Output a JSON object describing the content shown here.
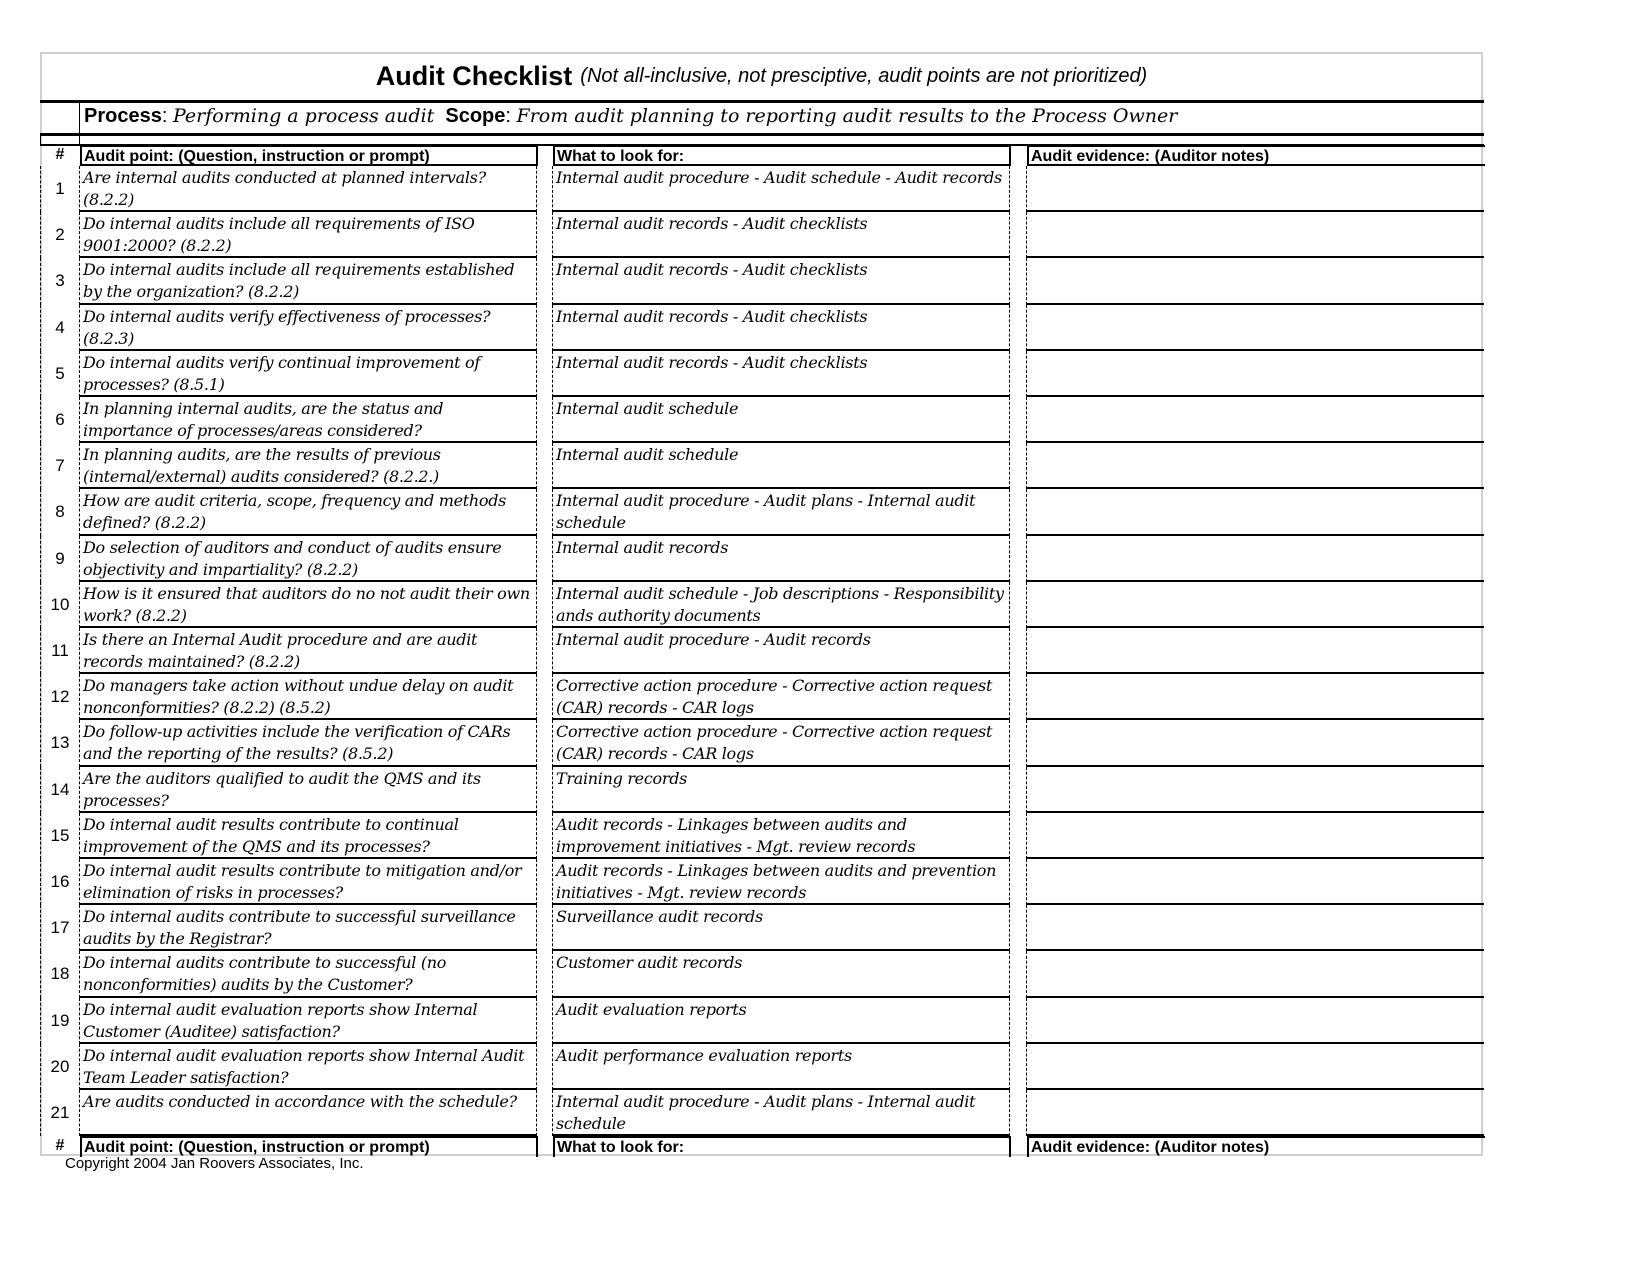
{
  "title": {
    "main": "Audit Checklist",
    "subtitle": "(Not all-inclusive, not presciptive, audit points are not prioritized)"
  },
  "process": {
    "process_label": "Process",
    "process_value": "Performing a process audit",
    "scope_label": "Scope",
    "scope_value": "From audit planning to reporting audit results to the Process Owner"
  },
  "headers": {
    "num": "#",
    "audit_point": "Audit point: (Question, instruction or prompt)",
    "look_for": "What to look for:",
    "evidence": "Audit evidence: (Auditor notes)"
  },
  "rows": [
    {
      "num": "1",
      "question": "Are internal audits conducted at planned intervals? (8.2.2)",
      "look_for": "Internal audit procedure - Audit schedule - Audit records",
      "evidence": ""
    },
    {
      "num": "2",
      "question": "Do internal audits include all requirements  of ISO 9001:2000? (8.2.2)",
      "look_for": "Internal audit records - Audit checklists",
      "evidence": ""
    },
    {
      "num": "3",
      "question": "Do internal audits include all requirements  established by the organization? (8.2.2)",
      "look_for": "Internal audit records - Audit checklists",
      "evidence": ""
    },
    {
      "num": "4",
      "question": "Do internal audits verify effectiveness of processes? (8.2.3)",
      "look_for": "Internal audit records - Audit checklists",
      "evidence": ""
    },
    {
      "num": "5",
      "question": "Do internal audits verify continual improvement of processes? (8.5.1)",
      "look_for": "Internal audit records - Audit checklists",
      "evidence": ""
    },
    {
      "num": "6",
      "question": "In planning internal audits, are the status and importance of processes/areas considered?",
      "look_for": "Internal audit schedule",
      "evidence": ""
    },
    {
      "num": "7",
      "question": "In planning audits, are the results of previous (internal/external) audits considered? (8.2.2.)",
      "look_for": "Internal audit schedule",
      "evidence": ""
    },
    {
      "num": "8",
      "question": "How are audit criteria, scope, frequency and methods defined? (8.2.2)",
      "look_for": "Internal audit procedure - Audit plans - Internal audit schedule",
      "evidence": ""
    },
    {
      "num": "9",
      "question": "Do selection of auditors and conduct of audits ensure objectivity and impartiality? (8.2.2)",
      "look_for": "Internal audit records",
      "evidence": ""
    },
    {
      "num": "10",
      "question": "How is it ensured that auditors do no not audit their own work? (8.2.2)",
      "look_for": "Internal audit schedule - Job descriptions - Responsibility ands authority documents",
      "evidence": ""
    },
    {
      "num": "11",
      "question": "Is there an Internal Audit procedure and are  audit records maintained? (8.2.2)",
      "look_for": "Internal audit procedure - Audit records",
      "evidence": ""
    },
    {
      "num": "12",
      "question": "Do managers take action without undue delay on audit nonconformities? (8.2.2) (8.5.2)",
      "look_for": "Corrective action procedure -  Corrective action request (CAR) records - CAR logs",
      "evidence": ""
    },
    {
      "num": "13",
      "question": "Do follow-up activities include the verification of CARs and the reporting of the results? (8.5.2)",
      "look_for": "Corrective action procedure -  Corrective action request (CAR) records - CAR logs",
      "evidence": ""
    },
    {
      "num": "14",
      "question": "Are the auditors qualified to audit the QMS and its processes?",
      "look_for": "Training records",
      "evidence": ""
    },
    {
      "num": "15",
      "question": "Do internal audit results contribute to continual improvement of the QMS and its processes?",
      "look_for": "Audit records - Linkages between audits and improvement initiatives - Mgt. review records",
      "evidence": ""
    },
    {
      "num": "16",
      "question": "Do internal audit results contribute to mitigation and/or elimination of risks in processes?",
      "look_for": "Audit records - Linkages between audits and prevention initiatives - Mgt. review records",
      "evidence": ""
    },
    {
      "num": "17",
      "question": "Do internal audits contribute to successful surveillance audits by the Registrar?",
      "look_for": "Surveillance audit records",
      "evidence": ""
    },
    {
      "num": "18",
      "question": "Do internal audits contribute to successful (no nonconformities) audits by the Customer?",
      "look_for": "Customer audit records",
      "evidence": ""
    },
    {
      "num": "19",
      "question": "Do internal audit evaluation reports show Internal Customer (Auditee) satisfaction?",
      "look_for": "Audit evaluation reports",
      "evidence": ""
    },
    {
      "num": "20",
      "question": "Do internal audit evaluation reports show Internal Audit Team Leader satisfaction?",
      "look_for": "Audit performance evaluation reports",
      "evidence": ""
    },
    {
      "num": "21",
      "question": "Are audits conducted in accordance with the schedule?",
      "look_for": "Internal audit procedure - Audit plans - Internal audit schedule",
      "evidence": ""
    }
  ],
  "footer": {
    "copyright": "Copyright 2004   Jan Roovers Associates, Inc."
  }
}
